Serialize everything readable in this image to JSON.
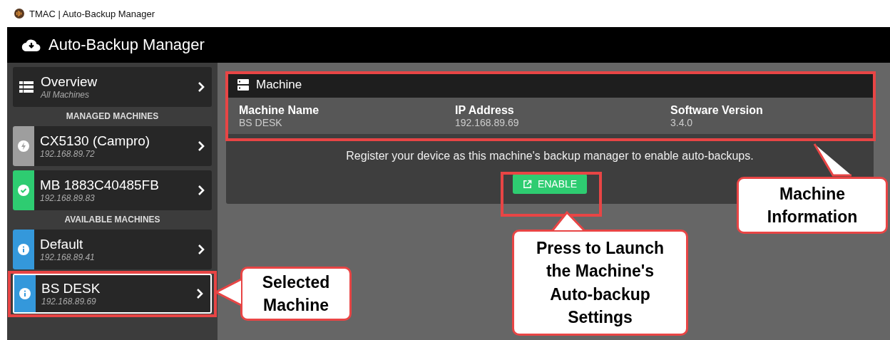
{
  "window": {
    "title": "TMAC | Auto-Backup Manager"
  },
  "app": {
    "title": "Auto-Backup Manager"
  },
  "sidebar": {
    "overview": {
      "label": "Overview",
      "sublabel": "All Machines"
    },
    "sections": [
      {
        "heading": "MANAGED MACHINES",
        "machines": [
          {
            "name": "CX5130 (Campro)",
            "ip": "192.168.89.72",
            "kind": "bolt",
            "color": "#9e9e9e",
            "selected": false
          },
          {
            "name": "MB 1883C40485FB",
            "ip": "192.168.89.83",
            "kind": "check",
            "color": "#2ecc71",
            "selected": false
          }
        ]
      },
      {
        "heading": "AVAILABLE MACHINES",
        "machines": [
          {
            "name": "Default",
            "ip": "192.168.89.41",
            "kind": "info",
            "color": "#3498db",
            "selected": false
          },
          {
            "name": "BS DESK",
            "ip": "192.168.89.69",
            "kind": "info",
            "color": "#3498db",
            "selected": true
          }
        ]
      }
    ]
  },
  "machine_card": {
    "title": "Machine",
    "fields": [
      {
        "label": "Machine Name",
        "value": "BS DESK"
      },
      {
        "label": "IP Address",
        "value": "192.168.89.69"
      },
      {
        "label": "Software Version",
        "value": "3.4.0"
      }
    ],
    "message": "Register your device as this machine's backup manager to enable auto-backups.",
    "button": "ENABLE"
  },
  "callouts": [
    {
      "kind": "selected",
      "text": "Selected Machine"
    },
    {
      "kind": "enable",
      "text": "Press to Launch the Machine's Auto-backup Settings"
    },
    {
      "kind": "info",
      "text": "Machine Information"
    }
  ]
}
